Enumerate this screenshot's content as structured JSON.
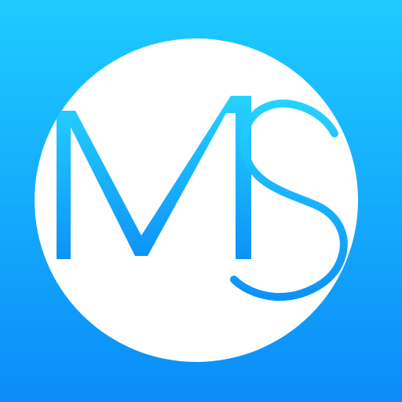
{
  "icon": {
    "name": "ms-logo-icon",
    "logo_text": "MS",
    "colors": {
      "gradient_top": "#1ecbff",
      "gradient_bottom": "#0b8cf9",
      "circle": "#ffffff",
      "letter_gradient_top": "#25d2ff",
      "letter_gradient_bottom": "#0d92f8"
    }
  }
}
